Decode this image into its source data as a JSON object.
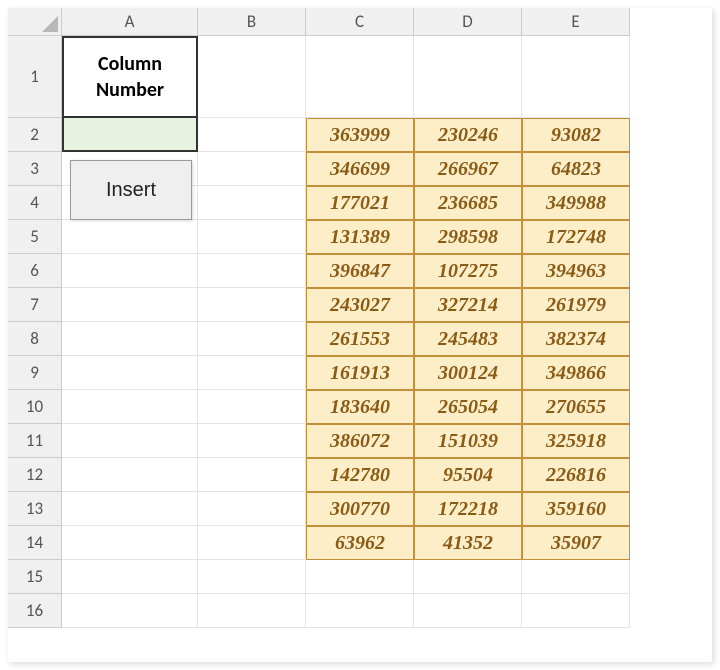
{
  "columns": [
    "A",
    "B",
    "C",
    "D",
    "E"
  ],
  "col_widths": {
    "A": 136,
    "B": 108,
    "C": 108,
    "D": 108,
    "E": 108
  },
  "row_count": 16,
  "row_heights": {
    "1": 82,
    "default": 34
  },
  "header_label_line1": "Column",
  "header_label_line2": "Number",
  "insert_button_label": "Insert",
  "chart_data": {
    "type": "table",
    "columns": [
      "C",
      "D",
      "E"
    ],
    "rows": [
      2,
      3,
      4,
      5,
      6,
      7,
      8,
      9,
      10,
      11,
      12,
      13,
      14
    ],
    "data": [
      [
        363999,
        230246,
        93082
      ],
      [
        346699,
        266967,
        64823
      ],
      [
        177021,
        236685,
        349988
      ],
      [
        131389,
        298598,
        172748
      ],
      [
        396847,
        107275,
        394963
      ],
      [
        243027,
        327214,
        261979
      ],
      [
        261553,
        245483,
        382374
      ],
      [
        161913,
        300124,
        349866
      ],
      [
        183640,
        265054,
        270655
      ],
      [
        386072,
        151039,
        325918
      ],
      [
        142780,
        95504,
        226816
      ],
      [
        300770,
        172218,
        359160
      ],
      [
        63962,
        41352,
        35907
      ]
    ]
  }
}
